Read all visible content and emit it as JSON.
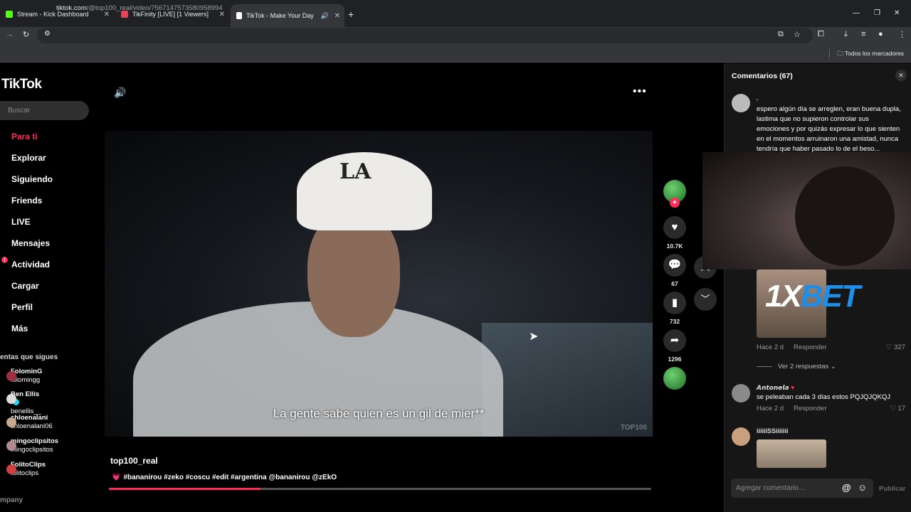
{
  "browser": {
    "tabs": [
      {
        "title": "Stream - Kick Dashboard",
        "favicon_color": "#53fc18"
      },
      {
        "title": "TikFinity [LIVE] [1 Viewers]",
        "favicon_color": "#e8425a"
      },
      {
        "title": "TikTok - Make Your Day",
        "favicon_color": "#ffffff"
      }
    ],
    "new_tab_icon": "plus-icon",
    "url_host": "tiktok.com",
    "url_path": "/@top100_real/video/7567147573580958994",
    "bookmarks_label": "Todos los marcadores"
  },
  "sidebar": {
    "logo": "TikTok",
    "search_placeholder": "Buscar",
    "items": [
      {
        "label": "Para ti"
      },
      {
        "label": "Explorar"
      },
      {
        "label": "Siguiendo"
      },
      {
        "label": "Friends"
      },
      {
        "label": "LIVE"
      },
      {
        "label": "Mensajes"
      },
      {
        "label": "Actividad",
        "badge": "1"
      },
      {
        "label": "Cargar"
      },
      {
        "label": "Perfil"
      },
      {
        "label": "Más"
      }
    ],
    "following_heading": "entas que sigues",
    "following": [
      {
        "name": "FolominG",
        "handle": "folomingg"
      },
      {
        "name": "Ben Ellis",
        "handle": "benellis__",
        "verified": true
      },
      {
        "name": "chloenalani",
        "handle": "chloenalani06"
      },
      {
        "name": "mingoclipsitos",
        "handle": "mingoclipsitos"
      },
      {
        "name": "FolitoClips",
        "handle": "folitoclips"
      }
    ],
    "company": "mpany"
  },
  "video": {
    "subtitle": "La gente sabe quien es un gil de mier**",
    "watermark": "TOP100",
    "cap_logo": "LA",
    "author": "top100_real",
    "caption": "#bananirou #zeko #coscu #edit #argentina @bananirou @zEkO",
    "progress": 0.28
  },
  "actions": {
    "likes": "10.7K",
    "comments": "67",
    "saves": "732",
    "shares": "1296"
  },
  "comments": {
    "title": "Comentarios (67)",
    "first": {
      "user": ".",
      "text": "espero algún día se arreglen, eran buena dupla, lastima que no supieron controlar sus emociones y por quizás expresar lo que sienten en el momentos arruinaron una amistad, nunca tendría que haber pasado lo de el beso..."
    },
    "second": {
      "time": "Hace 2 d",
      "reply": "Responder",
      "likes": "327"
    },
    "ver_respuestas": "Ver 2 respuestas",
    "third": {
      "user": "𝘼𝙣𝙩𝙤𝙣𝙚𝙡𝙖",
      "text": "se peleaban cada 3 días estos PQJQJQKQJ",
      "time": "Hace 2 d",
      "reply": "Responder",
      "likes": "17"
    },
    "fourth": {
      "user": "iiiiiiSSiiiiiii"
    },
    "input_placeholder": "Agregar comentario...",
    "publish": "Publicar"
  },
  "overlay": {
    "ad_part1": "1X",
    "ad_part2": "BET"
  }
}
